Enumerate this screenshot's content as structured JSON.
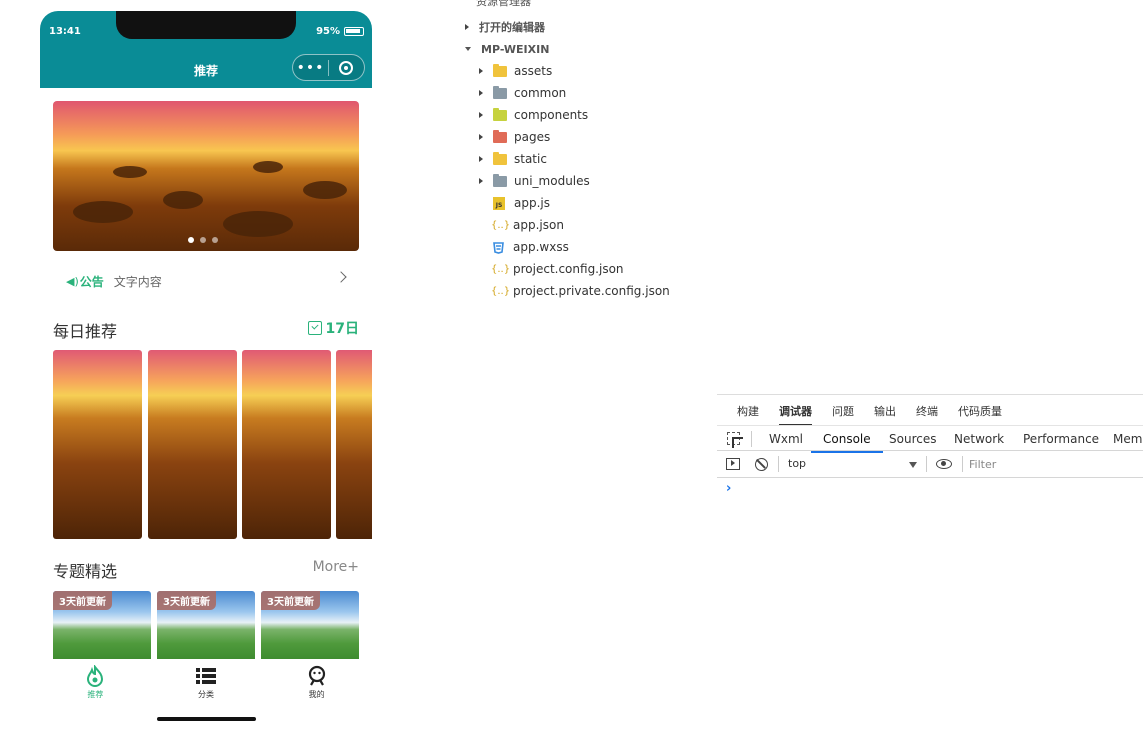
{
  "phone": {
    "status": {
      "time": "13:41",
      "battery": "95%"
    },
    "nav": {
      "title": "推荐",
      "menu_dots": "•••"
    },
    "banner": {
      "slide_index": 1,
      "slide_count": 3
    },
    "notice": {
      "label": "公告",
      "text": "文字内容",
      "icon": "speaker-icon"
    },
    "daily": {
      "title": "每日推荐",
      "date": "17日",
      "card_count": 4
    },
    "topics": {
      "title": "专题精选",
      "more": "More+",
      "cards": [
        {
          "tag": "3天前更新"
        },
        {
          "tag": "3天前更新"
        },
        {
          "tag": "3天前更新"
        }
      ]
    },
    "tabbar": [
      {
        "label": "推荐",
        "icon": "flame-icon",
        "active": true
      },
      {
        "label": "分类",
        "icon": "list-icon",
        "active": false
      },
      {
        "label": "我的",
        "icon": "user-icon",
        "active": false
      }
    ]
  },
  "explorer": {
    "title": "资源管理器",
    "groups": [
      {
        "label": "打开的编辑器",
        "expanded": false
      },
      {
        "label": "MP-WEIXIN",
        "expanded": true
      }
    ],
    "items": [
      {
        "name": "assets",
        "kind": "folder",
        "color": "#f0c33c"
      },
      {
        "name": "common",
        "kind": "folder",
        "color": "#8a9aa6"
      },
      {
        "name": "components",
        "kind": "folder",
        "color": "#c6d23e"
      },
      {
        "name": "pages",
        "kind": "folder",
        "color": "#e06b57"
      },
      {
        "name": "static",
        "kind": "folder",
        "color": "#f0c33c"
      },
      {
        "name": "uni_modules",
        "kind": "folder",
        "color": "#8a9aa6"
      },
      {
        "name": "app.js",
        "kind": "js"
      },
      {
        "name": "app.json",
        "kind": "json"
      },
      {
        "name": "app.wxss",
        "kind": "css"
      },
      {
        "name": "project.config.json",
        "kind": "json"
      },
      {
        "name": "project.private.config.json",
        "kind": "json"
      }
    ]
  },
  "devtools": {
    "panel_tabs": [
      "构建",
      "调试器",
      "问题",
      "输出",
      "终端",
      "代码质量"
    ],
    "active_panel": "调试器",
    "tabs": [
      "Wxml",
      "Console",
      "Sources",
      "Network",
      "Performance",
      "Memo"
    ],
    "active_tab": "Console",
    "context": "top",
    "filter_placeholder": "Filter",
    "prompt": "›"
  },
  "colors": {
    "nav_bg": "#0a8c96",
    "accent": "#2ab27b",
    "link_blue": "#1a73e8"
  }
}
